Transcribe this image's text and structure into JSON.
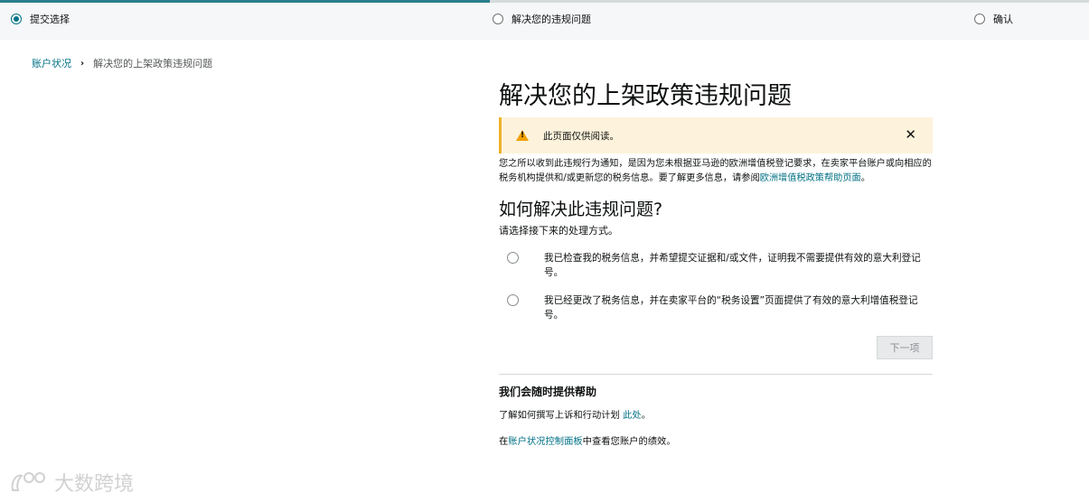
{
  "stepper": {
    "steps": [
      {
        "label": "提交选择",
        "active": true
      },
      {
        "label": "解决您的违规问题",
        "active": false
      },
      {
        "label": "确认",
        "active": false
      }
    ],
    "accent_color": "#2a7f8a"
  },
  "breadcrumb": {
    "parent": "账户状况",
    "current": "解决您的上架政策违规问题"
  },
  "page": {
    "title": "解决您的上架政策违规问题",
    "alert": {
      "text": "此页面仅供阅读。",
      "close": "✕",
      "icon": "warning-icon"
    },
    "description": {
      "text": "您之所以收到此违规行为通知，是因为您未根据亚马逊的欧洲增值税登记要求，在卖家平台账户或向相应的税务机构提供和/或更新您的税务信息。要了解更多信息，请参阅",
      "link": "欧洲增值税政策帮助页面",
      "end": "。"
    },
    "section_title": "如何解决此违规问题?",
    "section_sub": "请选择接下来的处理方式。",
    "options": [
      {
        "label": "我已检查我的税务信息，并希望提交证据和/或文件，证明我不需要提供有效的意大利登记号。"
      },
      {
        "label": "我已经更改了税务信息，并在卖家平台的“税务设置”页面提供了有效的意大利增值税登记号。"
      }
    ],
    "next_button": "下一项"
  },
  "help": {
    "title": "我们会随时提供帮助",
    "line1_text": "了解如何撰写上诉和行动计划 ",
    "line1_link": "此处",
    "line1_end": "。",
    "line2_start": "在",
    "line2_link": "账户状况控制面板",
    "line2_end": "中查看您账户的绩效。"
  },
  "watermark": {
    "text": "大数跨境",
    "icon": "watermark-logo"
  }
}
